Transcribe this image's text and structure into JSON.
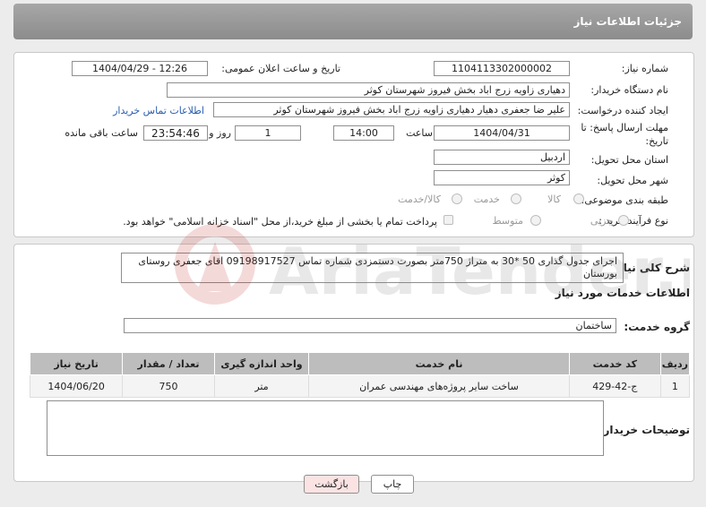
{
  "header": {
    "title": "جزئیات اطلاعات نیاز"
  },
  "fields": {
    "need_number_label": "شماره نیاز:",
    "need_number": "1104113302000002",
    "announce_label": "تاریخ و ساعت اعلان عمومی:",
    "announce_value": "1404/04/29 - 12:26",
    "buyer_org_label": "نام دستگاه خریدار:",
    "buyer_org": "دهیاری زاویه زرج اباد بخش فیروز شهرستان کوثر",
    "creator_label": "ایجاد کننده درخواست:",
    "creator": "علیر ضا  جعفری  دهیار  دهیاری زاویه زرج اباد بخش فیروز شهرستان کوثر",
    "contact_link": "اطلاعات تماس خریدار",
    "deadline_label_1": "مهلت ارسال پاسخ: تا",
    "deadline_label_2": "تاریخ:",
    "deadline_date": "1404/04/31",
    "time_label": "ساعت",
    "deadline_time": "14:00",
    "days_value": "1",
    "days_label": "روز و",
    "remaining_time": "23:54:46",
    "remaining_label": "ساعت باقی مانده",
    "province_label": "استان محل تحویل:",
    "province": "اردبیل",
    "city_label": "شهر محل تحویل:",
    "city": "کوثر",
    "category_label": "طبقه بندی موضوعی:",
    "category_options": [
      "کالا",
      "خدمت",
      "کالا/خدمت"
    ],
    "process_label": "نوع فرآیند خرید :",
    "process_options": [
      "جزیی",
      "متوسط"
    ],
    "payment_note": "پرداخت تمام یا بخشی از مبلغ خرید،از محل \"اسناد خزانه اسلامی\" خواهد بود."
  },
  "description": {
    "label": "شرح کلی نیاز:",
    "text": "اجرای جدول گذاری 50  *30   به متراژ 750متر بصورت دستمزدی شماره تماس 09198917527 اقای جعفری روستای بورستان"
  },
  "services": {
    "section_title": "اطلاعات خدمات مورد نیاز",
    "group_label": "گروه خدمت:",
    "group_value": "ساختمان",
    "columns": [
      "ردیف",
      "کد خدمت",
      "نام خدمت",
      "واحد اندازه گیری",
      "تعداد / مقدار",
      "تاریخ نیاز"
    ],
    "rows": [
      [
        "1",
        "ج-42-429",
        "ساخت سایر پروژه‌های مهندسی عمران",
        "متر",
        "750",
        "1404/06/20"
      ]
    ]
  },
  "buyer_notes": {
    "label": "توضیحات خریدار:",
    "value": ""
  },
  "buttons": {
    "print": "چاپ",
    "back": "بازگشت"
  },
  "watermark_text": "AriaTender.neT"
}
